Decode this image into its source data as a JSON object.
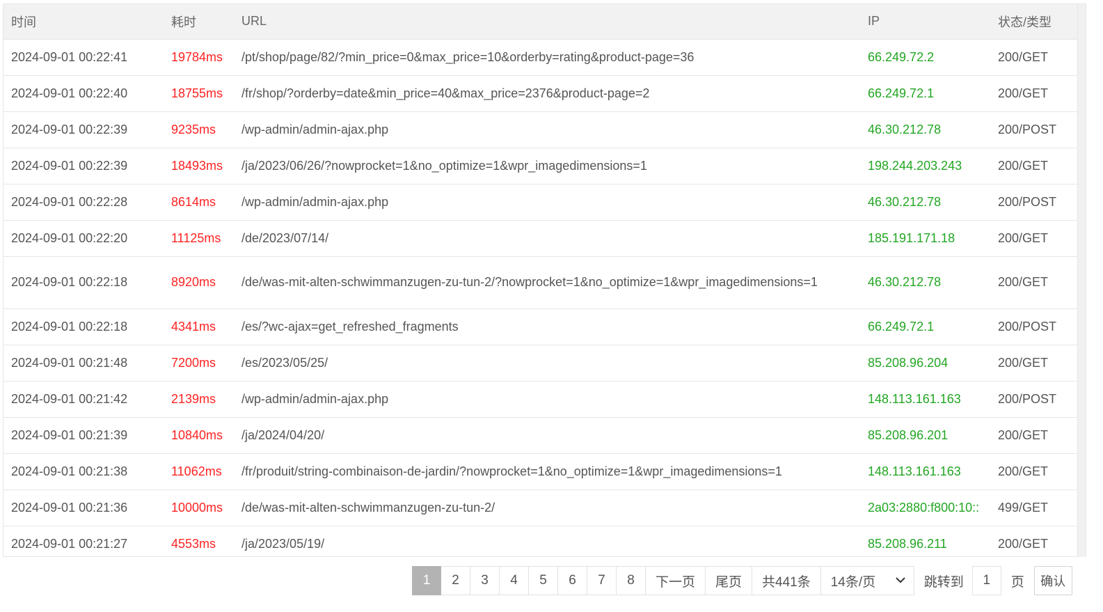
{
  "table": {
    "headers": {
      "time": "时间",
      "duration": "耗时",
      "url": "URL",
      "ip": "IP",
      "status": "状态/类型"
    },
    "rows": [
      {
        "time": "2024-09-01 00:22:41",
        "duration": "19784ms",
        "url": "/pt/shop/page/82/?min_price=0&max_price=10&orderby=rating&product-page=36",
        "ip": "66.249.72.2",
        "status": "200/GET"
      },
      {
        "time": "2024-09-01 00:22:40",
        "duration": "18755ms",
        "url": "/fr/shop/?orderby=date&min_price=40&max_price=2376&product-page=2",
        "ip": "66.249.72.1",
        "status": "200/GET"
      },
      {
        "time": "2024-09-01 00:22:39",
        "duration": "9235ms",
        "url": "/wp-admin/admin-ajax.php",
        "ip": "46.30.212.78",
        "status": "200/POST"
      },
      {
        "time": "2024-09-01 00:22:39",
        "duration": "18493ms",
        "url": "/ja/2023/06/26/?nowprocket=1&no_optimize=1&wpr_imagedimensions=1",
        "ip": "198.244.203.243",
        "status": "200/GET"
      },
      {
        "time": "2024-09-01 00:22:28",
        "duration": "8614ms",
        "url": "/wp-admin/admin-ajax.php",
        "ip": "46.30.212.78",
        "status": "200/POST"
      },
      {
        "time": "2024-09-01 00:22:20",
        "duration": "11125ms",
        "url": "/de/2023/07/14/",
        "ip": "185.191.171.18",
        "status": "200/GET"
      },
      {
        "time": "2024-09-01 00:22:18",
        "duration": "8920ms",
        "url": "/de/was-mit-alten-schwimmanzugen-zu-tun-2/?nowprocket=1&no_optimize=1&wpr_imagedimensions=1",
        "ip": "46.30.212.78",
        "status": "200/GET"
      },
      {
        "time": "2024-09-01 00:22:18",
        "duration": "4341ms",
        "url": "/es/?wc-ajax=get_refreshed_fragments",
        "ip": "66.249.72.1",
        "status": "200/POST"
      },
      {
        "time": "2024-09-01 00:21:48",
        "duration": "7200ms",
        "url": "/es/2023/05/25/",
        "ip": "85.208.96.204",
        "status": "200/GET"
      },
      {
        "time": "2024-09-01 00:21:42",
        "duration": "2139ms",
        "url": "/wp-admin/admin-ajax.php",
        "ip": "148.113.161.163",
        "status": "200/POST"
      },
      {
        "time": "2024-09-01 00:21:39",
        "duration": "10840ms",
        "url": "/ja/2024/04/20/",
        "ip": "85.208.96.201",
        "status": "200/GET"
      },
      {
        "time": "2024-09-01 00:21:38",
        "duration": "11062ms",
        "url": "/fr/produit/string-combinaison-de-jardin/?nowprocket=1&no_optimize=1&wpr_imagedimensions=1",
        "ip": "148.113.161.163",
        "status": "200/GET"
      },
      {
        "time": "2024-09-01 00:21:36",
        "duration": "10000ms",
        "url": "/de/was-mit-alten-schwimmanzugen-zu-tun-2/",
        "ip": "2a03:2880:f800:10::",
        "status": "499/GET"
      },
      {
        "time": "2024-09-01 00:21:27",
        "duration": "4553ms",
        "url": "/ja/2023/05/19/",
        "ip": "85.208.96.211",
        "status": "200/GET"
      }
    ]
  },
  "pagination": {
    "pages": [
      "1",
      "2",
      "3",
      "4",
      "5",
      "6",
      "7",
      "8"
    ],
    "current_page": "1",
    "next_label": "下一页",
    "last_label": "尾页",
    "total_label": "共441条",
    "page_size_label": "14条/页",
    "jump_label": "跳转到",
    "jump_value": "1",
    "page_unit_label": "页",
    "confirm_label": "确认"
  },
  "colors": {
    "duration": "#ff2222",
    "ip": "#22a622",
    "current_page_bg": "#b3b3b3"
  }
}
